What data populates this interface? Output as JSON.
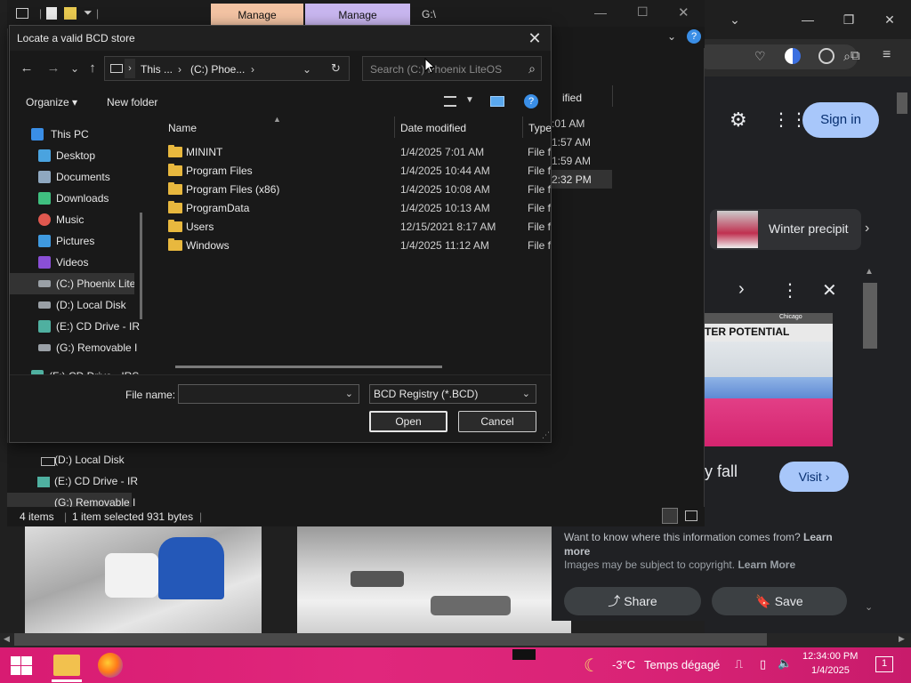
{
  "background_explorer": {
    "tabs": [
      "Manage",
      "Manage"
    ],
    "path_label": "G:\\",
    "date_col_partial": "ified",
    "times_partial": [
      ":01 AM",
      "1:57 AM",
      "1:59 AM",
      "2:32 PM"
    ],
    "tree_extra": [
      "(D:) Local Disk",
      "(E:) CD Drive - IR",
      "(G:) Removable I"
    ],
    "tree_partial": "(F:) CD Drive - IRS",
    "status": {
      "items": "4 items",
      "selected": "1 item selected  931 bytes"
    }
  },
  "browser": {
    "sign_in": "Sign in",
    "card_title": "Winter precipit",
    "map_headline": "TER POTENTIAL",
    "map_city": "Chicago",
    "partial_text": "y fall",
    "visit": "Visit",
    "info_text": "Want to know where this information comes from?",
    "learn_more": "Learn more",
    "copyright": "Images may be subject to copyright.",
    "learn_more2": "Learn More",
    "share": "Share",
    "save": "Save"
  },
  "dialog": {
    "title": "Locate a valid BCD store",
    "address": {
      "seg1": "This ...",
      "seg2": "(C:) Phoe..."
    },
    "search_placeholder": "Search (C:) Phoenix LiteOS",
    "organize": "Organize",
    "new_folder": "New folder",
    "tree": [
      {
        "label": "This PC",
        "color": "#3a8ee6"
      },
      {
        "label": "Desktop",
        "color": "#4aa3df"
      },
      {
        "label": "Documents",
        "color": "#8fa8c0"
      },
      {
        "label": "Downloads",
        "color": "#3fbf7f"
      },
      {
        "label": "Music",
        "color": "#e0584f"
      },
      {
        "label": "Pictures",
        "color": "#3f9ae0"
      },
      {
        "label": "Videos",
        "color": "#8a4fd6"
      },
      {
        "label": "(C:) Phoenix Lite",
        "color": "#9aa0a6",
        "selected": true
      },
      {
        "label": "(D:) Local Disk",
        "color": "#9aa0a6"
      },
      {
        "label": "(E:) CD Drive - IR",
        "color": "#4fb0a0"
      },
      {
        "label": "(G:) Removable I",
        "color": "#9aa0a6"
      },
      {
        "label": "(F:) CD Drive - IRS",
        "color": "#4fb0a0"
      }
    ],
    "columns": {
      "name": "Name",
      "date": "Date modified",
      "type": "Type"
    },
    "files": [
      {
        "name": "MININT",
        "date": "1/4/2025 7:01 AM",
        "type": "File fo"
      },
      {
        "name": "Program Files",
        "date": "1/4/2025 10:44 AM",
        "type": "File fo"
      },
      {
        "name": "Program Files (x86)",
        "date": "1/4/2025 10:08 AM",
        "type": "File fo"
      },
      {
        "name": "ProgramData",
        "date": "1/4/2025 10:13 AM",
        "type": "File fo"
      },
      {
        "name": "Users",
        "date": "12/15/2021 8:17 AM",
        "type": "File fo"
      },
      {
        "name": "Windows",
        "date": "1/4/2025 11:12 AM",
        "type": "File fo"
      }
    ],
    "file_name_label": "File name:",
    "file_name_value": "",
    "filter": "BCD Registry (*.BCD)",
    "open": "Open",
    "cancel": "Cancel"
  },
  "taskbar": {
    "weather_temp": "-3°C",
    "weather_desc": "Temps dégagé",
    "time": "12:34:00 PM",
    "date": "1/4/2025",
    "notif_count": "1"
  }
}
